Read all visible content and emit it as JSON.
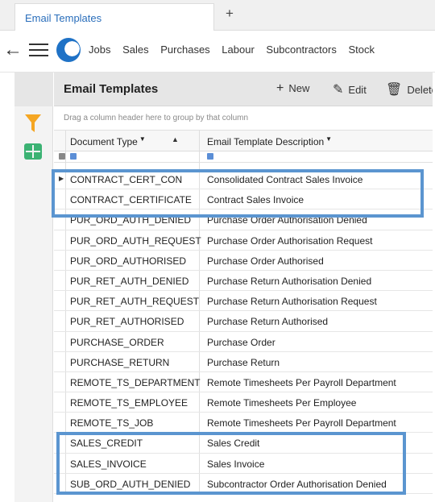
{
  "tab": {
    "title": "Email Templates",
    "add_label": "+"
  },
  "nav": {
    "back_glyph": "←",
    "items": [
      "Jobs",
      "Sales",
      "Purchases",
      "Labour",
      "Subcontractors",
      "Stock"
    ]
  },
  "toolbar": {
    "title": "Email Templates",
    "new_label": "New",
    "edit_label": "Edit",
    "delete_label": "Delete"
  },
  "grid": {
    "group_hint": "Drag a column header here to group by that column",
    "columns": [
      "Document Type",
      "Email Template Description"
    ],
    "rows": [
      [
        "CONTRACT_CERT_CON",
        "Consolidated Contract Sales Invoice"
      ],
      [
        "CONTRACT_CERTIFICATE",
        "Contract Sales Invoice"
      ],
      [
        "PUR_ORD_AUTH_DENIED",
        "Purchase Order Authorisation Denied"
      ],
      [
        "PUR_ORD_AUTH_REQUEST",
        "Purchase Order Authorisation Request"
      ],
      [
        "PUR_ORD_AUTHORISED",
        "Purchase Order Authorised"
      ],
      [
        "PUR_RET_AUTH_DENIED",
        "Purchase Return Authorisation Denied"
      ],
      [
        "PUR_RET_AUTH_REQUEST",
        "Purchase Return Authorisation Request"
      ],
      [
        "PUR_RET_AUTHORISED",
        "Purchase Return Authorised"
      ],
      [
        "PURCHASE_ORDER",
        "Purchase Order"
      ],
      [
        "PURCHASE_RETURN",
        "Purchase Return"
      ],
      [
        "REMOTE_TS_DEPARTMENT",
        "Remote Timesheets Per Payroll Department"
      ],
      [
        "REMOTE_TS_EMPLOYEE",
        "Remote Timesheets Per Employee"
      ],
      [
        "REMOTE_TS_JOB",
        "Remote Timesheets Per Payroll Department"
      ],
      [
        "SALES_CREDIT",
        "Sales Credit"
      ],
      [
        "SALES_INVOICE",
        "Sales Invoice"
      ],
      [
        "SUB_ORD_AUTH_DENIED",
        "Subcontractor Order Authorisation Denied"
      ]
    ]
  },
  "colors": {
    "accent": "#2a6ebb",
    "highlight": "#5b95d0",
    "filter": "#f5a623",
    "grid_icon": "#3bb273"
  }
}
